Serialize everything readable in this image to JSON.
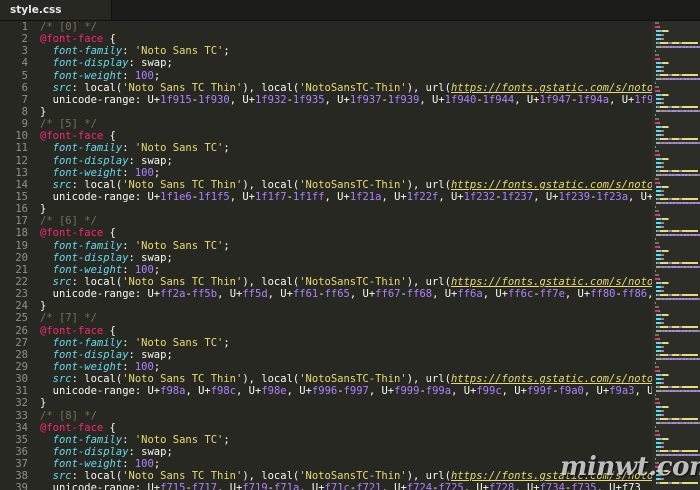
{
  "tab": {
    "title": "style.css"
  },
  "colors": {
    "background": "#272822",
    "comment": "#75715e",
    "at_rule": "#f92672",
    "property": "#66d9ef",
    "string": "#e6db74",
    "number": "#ae81ff",
    "text": "#f8f8f2"
  },
  "editor": {
    "line_numbers": [
      "1",
      "2",
      "3",
      "4",
      "5",
      "6",
      "7",
      "8",
      "9",
      "10",
      "11",
      "12",
      "13",
      "14",
      "15",
      "16",
      "17",
      "18",
      "19",
      "20",
      "21",
      "22",
      "23",
      "24",
      "25",
      "26",
      "27",
      "28",
      "29",
      "30",
      "31",
      "32",
      "33",
      "34",
      "35",
      "36",
      "37",
      "38",
      "39"
    ],
    "lines": [
      [
        [
          "comment",
          "/* [0] */"
        ]
      ],
      [
        [
          "at",
          "@font-face"
        ],
        [
          "brace",
          " {"
        ]
      ],
      [
        [
          "punct",
          "  "
        ],
        [
          "prop",
          "font-family"
        ],
        [
          "punct",
          ": "
        ],
        [
          "str",
          "'Noto Sans TC'"
        ],
        [
          "punct",
          ";"
        ]
      ],
      [
        [
          "punct",
          "  "
        ],
        [
          "prop",
          "font-display"
        ],
        [
          "punct",
          ": swap;"
        ]
      ],
      [
        [
          "punct",
          "  "
        ],
        [
          "prop",
          "font-weight"
        ],
        [
          "punct",
          ": "
        ],
        [
          "num",
          "100"
        ],
        [
          "punct",
          ";"
        ]
      ],
      [
        [
          "punct",
          "  "
        ],
        [
          "prop",
          "src"
        ],
        [
          "punct",
          ": local("
        ],
        [
          "str",
          "'Noto Sans TC Thin'"
        ],
        [
          "punct",
          "), local("
        ],
        [
          "str",
          "'NotoSansTC-Thin'"
        ],
        [
          "punct",
          "), url("
        ],
        [
          "url",
          "https://fonts.gstatic.com/s/notosanst"
        ]
      ],
      [
        [
          "punct",
          "  "
        ],
        [
          "propplain",
          "unicode-range"
        ],
        [
          "punct",
          ": U+"
        ],
        [
          "num",
          "1f915"
        ],
        [
          "punct",
          "-"
        ],
        [
          "num",
          "1f930"
        ],
        [
          "punct",
          ", U+"
        ],
        [
          "num",
          "1f932"
        ],
        [
          "punct",
          "-"
        ],
        [
          "num",
          "1f935"
        ],
        [
          "punct",
          ", U+"
        ],
        [
          "num",
          "1f937"
        ],
        [
          "punct",
          "-"
        ],
        [
          "num",
          "1f939"
        ],
        [
          "punct",
          ", U+"
        ],
        [
          "num",
          "1f940"
        ],
        [
          "punct",
          "-"
        ],
        [
          "num",
          "1f944"
        ],
        [
          "punct",
          ", U+"
        ],
        [
          "num",
          "1f947"
        ],
        [
          "punct",
          "-"
        ],
        [
          "num",
          "1f94a"
        ],
        [
          "punct",
          ", U+"
        ],
        [
          "num",
          "1f950"
        ],
        [
          "punct",
          "-1f"
        ]
      ],
      [
        [
          "brace",
          "}"
        ]
      ],
      [
        [
          "comment",
          "/* [5] */"
        ]
      ],
      [
        [
          "at",
          "@font-face"
        ],
        [
          "brace",
          " {"
        ]
      ],
      [
        [
          "punct",
          "  "
        ],
        [
          "prop",
          "font-family"
        ],
        [
          "punct",
          ": "
        ],
        [
          "str",
          "'Noto Sans TC'"
        ],
        [
          "punct",
          ";"
        ]
      ],
      [
        [
          "punct",
          "  "
        ],
        [
          "prop",
          "font-display"
        ],
        [
          "punct",
          ": swap;"
        ]
      ],
      [
        [
          "punct",
          "  "
        ],
        [
          "prop",
          "font-weight"
        ],
        [
          "punct",
          ": "
        ],
        [
          "num",
          "100"
        ],
        [
          "punct",
          ";"
        ]
      ],
      [
        [
          "punct",
          "  "
        ],
        [
          "prop",
          "src"
        ],
        [
          "punct",
          ": local("
        ],
        [
          "str",
          "'Noto Sans TC Thin'"
        ],
        [
          "punct",
          "), local("
        ],
        [
          "str",
          "'NotoSansTC-Thin'"
        ],
        [
          "punct",
          "), url("
        ],
        [
          "url",
          "https://fonts.gstatic.com/s/notosanst"
        ]
      ],
      [
        [
          "punct",
          "  "
        ],
        [
          "propplain",
          "unicode-range"
        ],
        [
          "punct",
          ": U+"
        ],
        [
          "num",
          "1f1e6"
        ],
        [
          "punct",
          "-"
        ],
        [
          "num",
          "1f1f5"
        ],
        [
          "punct",
          ", U+"
        ],
        [
          "num",
          "1f1f7"
        ],
        [
          "punct",
          "-"
        ],
        [
          "num",
          "1f1ff"
        ],
        [
          "punct",
          ", U+"
        ],
        [
          "num",
          "1f21a"
        ],
        [
          "punct",
          ", U+"
        ],
        [
          "num",
          "1f22f"
        ],
        [
          "punct",
          ", U+"
        ],
        [
          "num",
          "1f232"
        ],
        [
          "punct",
          "-"
        ],
        [
          "num",
          "1f237"
        ],
        [
          "punct",
          ", U+"
        ],
        [
          "num",
          "1f239"
        ],
        [
          "punct",
          "-"
        ],
        [
          "num",
          "1f23a"
        ],
        [
          "punct",
          ", U+"
        ],
        [
          "num",
          "1f250"
        ]
      ],
      [
        [
          "brace",
          "}"
        ]
      ],
      [
        [
          "comment",
          "/* [6] */"
        ]
      ],
      [
        [
          "at",
          "@font-face"
        ],
        [
          "brace",
          " {"
        ]
      ],
      [
        [
          "punct",
          "  "
        ],
        [
          "prop",
          "font-family"
        ],
        [
          "punct",
          ": "
        ],
        [
          "str",
          "'Noto Sans TC'"
        ],
        [
          "punct",
          ";"
        ]
      ],
      [
        [
          "punct",
          "  "
        ],
        [
          "prop",
          "font-display"
        ],
        [
          "punct",
          ": swap;"
        ]
      ],
      [
        [
          "punct",
          "  "
        ],
        [
          "prop",
          "font-weight"
        ],
        [
          "punct",
          ": "
        ],
        [
          "num",
          "100"
        ],
        [
          "punct",
          ";"
        ]
      ],
      [
        [
          "punct",
          "  "
        ],
        [
          "prop",
          "src"
        ],
        [
          "punct",
          ": local("
        ],
        [
          "str",
          "'Noto Sans TC Thin'"
        ],
        [
          "punct",
          "), local("
        ],
        [
          "str",
          "'NotoSansTC-Thin'"
        ],
        [
          "punct",
          "), url("
        ],
        [
          "url",
          "https://fonts.gstatic.com/s/notosanst"
        ]
      ],
      [
        [
          "punct",
          "  "
        ],
        [
          "propplain",
          "unicode-range"
        ],
        [
          "punct",
          ": U+"
        ],
        [
          "num",
          "ff2a"
        ],
        [
          "punct",
          "-"
        ],
        [
          "num",
          "ff5b"
        ],
        [
          "punct",
          ", U+"
        ],
        [
          "num",
          "ff5d"
        ],
        [
          "punct",
          ", U+"
        ],
        [
          "num",
          "ff61"
        ],
        [
          "punct",
          "-"
        ],
        [
          "num",
          "ff65"
        ],
        [
          "punct",
          ", U+"
        ],
        [
          "num",
          "ff67"
        ],
        [
          "punct",
          "-"
        ],
        [
          "num",
          "ff68"
        ],
        [
          "punct",
          ", U+"
        ],
        [
          "num",
          "ff6a"
        ],
        [
          "punct",
          ", U+"
        ],
        [
          "num",
          "ff6c"
        ],
        [
          "punct",
          "-"
        ],
        [
          "num",
          "ff7e"
        ],
        [
          "punct",
          ", U+"
        ],
        [
          "num",
          "ff80"
        ],
        [
          "punct",
          "-"
        ],
        [
          "num",
          "ff86"
        ],
        [
          "punct",
          ", U+f"
        ]
      ],
      [
        [
          "brace",
          "}"
        ]
      ],
      [
        [
          "comment",
          "/* [7] */"
        ]
      ],
      [
        [
          "at",
          "@font-face"
        ],
        [
          "brace",
          " {"
        ]
      ],
      [
        [
          "punct",
          "  "
        ],
        [
          "prop",
          "font-family"
        ],
        [
          "punct",
          ": "
        ],
        [
          "str",
          "'Noto Sans TC'"
        ],
        [
          "punct",
          ";"
        ]
      ],
      [
        [
          "punct",
          "  "
        ],
        [
          "prop",
          "font-display"
        ],
        [
          "punct",
          ": swap;"
        ]
      ],
      [
        [
          "punct",
          "  "
        ],
        [
          "prop",
          "font-weight"
        ],
        [
          "punct",
          ": "
        ],
        [
          "num",
          "100"
        ],
        [
          "punct",
          ";"
        ]
      ],
      [
        [
          "punct",
          "  "
        ],
        [
          "prop",
          "src"
        ],
        [
          "punct",
          ": local("
        ],
        [
          "str",
          "'Noto Sans TC Thin'"
        ],
        [
          "punct",
          "), local("
        ],
        [
          "str",
          "'NotoSansTC-Thin'"
        ],
        [
          "punct",
          "), url("
        ],
        [
          "url",
          "https://fonts.gstatic.com/s/notosanst"
        ]
      ],
      [
        [
          "punct",
          "  "
        ],
        [
          "propplain",
          "unicode-range"
        ],
        [
          "punct",
          ": U+"
        ],
        [
          "num",
          "f98a"
        ],
        [
          "punct",
          ", U+"
        ],
        [
          "num",
          "f98c"
        ],
        [
          "punct",
          ", U+"
        ],
        [
          "num",
          "f98e"
        ],
        [
          "punct",
          ", U+"
        ],
        [
          "num",
          "f996"
        ],
        [
          "punct",
          "-"
        ],
        [
          "num",
          "f997"
        ],
        [
          "punct",
          ", U+"
        ],
        [
          "num",
          "f999"
        ],
        [
          "punct",
          "-"
        ],
        [
          "num",
          "f99a"
        ],
        [
          "punct",
          ", U+"
        ],
        [
          "num",
          "f99c"
        ],
        [
          "punct",
          ", U+"
        ],
        [
          "num",
          "f99f"
        ],
        [
          "punct",
          "-"
        ],
        [
          "num",
          "f9a0"
        ],
        [
          "punct",
          ", U+"
        ],
        [
          "num",
          "f9a3"
        ],
        [
          "punct",
          ", U+f9a8"
        ]
      ],
      [
        [
          "brace",
          "}"
        ]
      ],
      [
        [
          "comment",
          "/* [8] */"
        ]
      ],
      [
        [
          "at",
          "@font-face"
        ],
        [
          "brace",
          " {"
        ]
      ],
      [
        [
          "punct",
          "  "
        ],
        [
          "prop",
          "font-family"
        ],
        [
          "punct",
          ": "
        ],
        [
          "str",
          "'Noto Sans TC'"
        ],
        [
          "punct",
          ";"
        ]
      ],
      [
        [
          "punct",
          "  "
        ],
        [
          "prop",
          "font-display"
        ],
        [
          "punct",
          ": swap;"
        ]
      ],
      [
        [
          "punct",
          "  "
        ],
        [
          "prop",
          "font-weight"
        ],
        [
          "punct",
          ": "
        ],
        [
          "num",
          "100"
        ],
        [
          "punct",
          ";"
        ]
      ],
      [
        [
          "punct",
          "  "
        ],
        [
          "prop",
          "src"
        ],
        [
          "punct",
          ": local("
        ],
        [
          "str",
          "'Noto Sans TC Thin'"
        ],
        [
          "punct",
          "), local("
        ],
        [
          "str",
          "'NotoSansTC-Thin'"
        ],
        [
          "punct",
          "), url("
        ],
        [
          "url",
          "https://fonts.gstatic.com/s/notosanst"
        ]
      ],
      [
        [
          "punct",
          "  "
        ],
        [
          "propplain",
          "unicode-range"
        ],
        [
          "punct",
          ": U+"
        ],
        [
          "num",
          "f715"
        ],
        [
          "punct",
          "-"
        ],
        [
          "num",
          "f717"
        ],
        [
          "punct",
          ", U+"
        ],
        [
          "num",
          "f719"
        ],
        [
          "punct",
          "-"
        ],
        [
          "num",
          "f71a"
        ],
        [
          "punct",
          ", U+"
        ],
        [
          "num",
          "f71c"
        ],
        [
          "punct",
          "-"
        ],
        [
          "num",
          "f721"
        ],
        [
          "punct",
          ", U+"
        ],
        [
          "num",
          "f724"
        ],
        [
          "punct",
          "-"
        ],
        [
          "num",
          "f725"
        ],
        [
          "punct",
          ", U+"
        ],
        [
          "num",
          "f728"
        ],
        [
          "punct",
          ", U+"
        ],
        [
          "num",
          "f734"
        ],
        [
          "punct",
          "-"
        ],
        [
          "num",
          "f735"
        ],
        [
          "punct",
          ", U+f73"
        ]
      ]
    ]
  },
  "watermark": "minwt.com"
}
